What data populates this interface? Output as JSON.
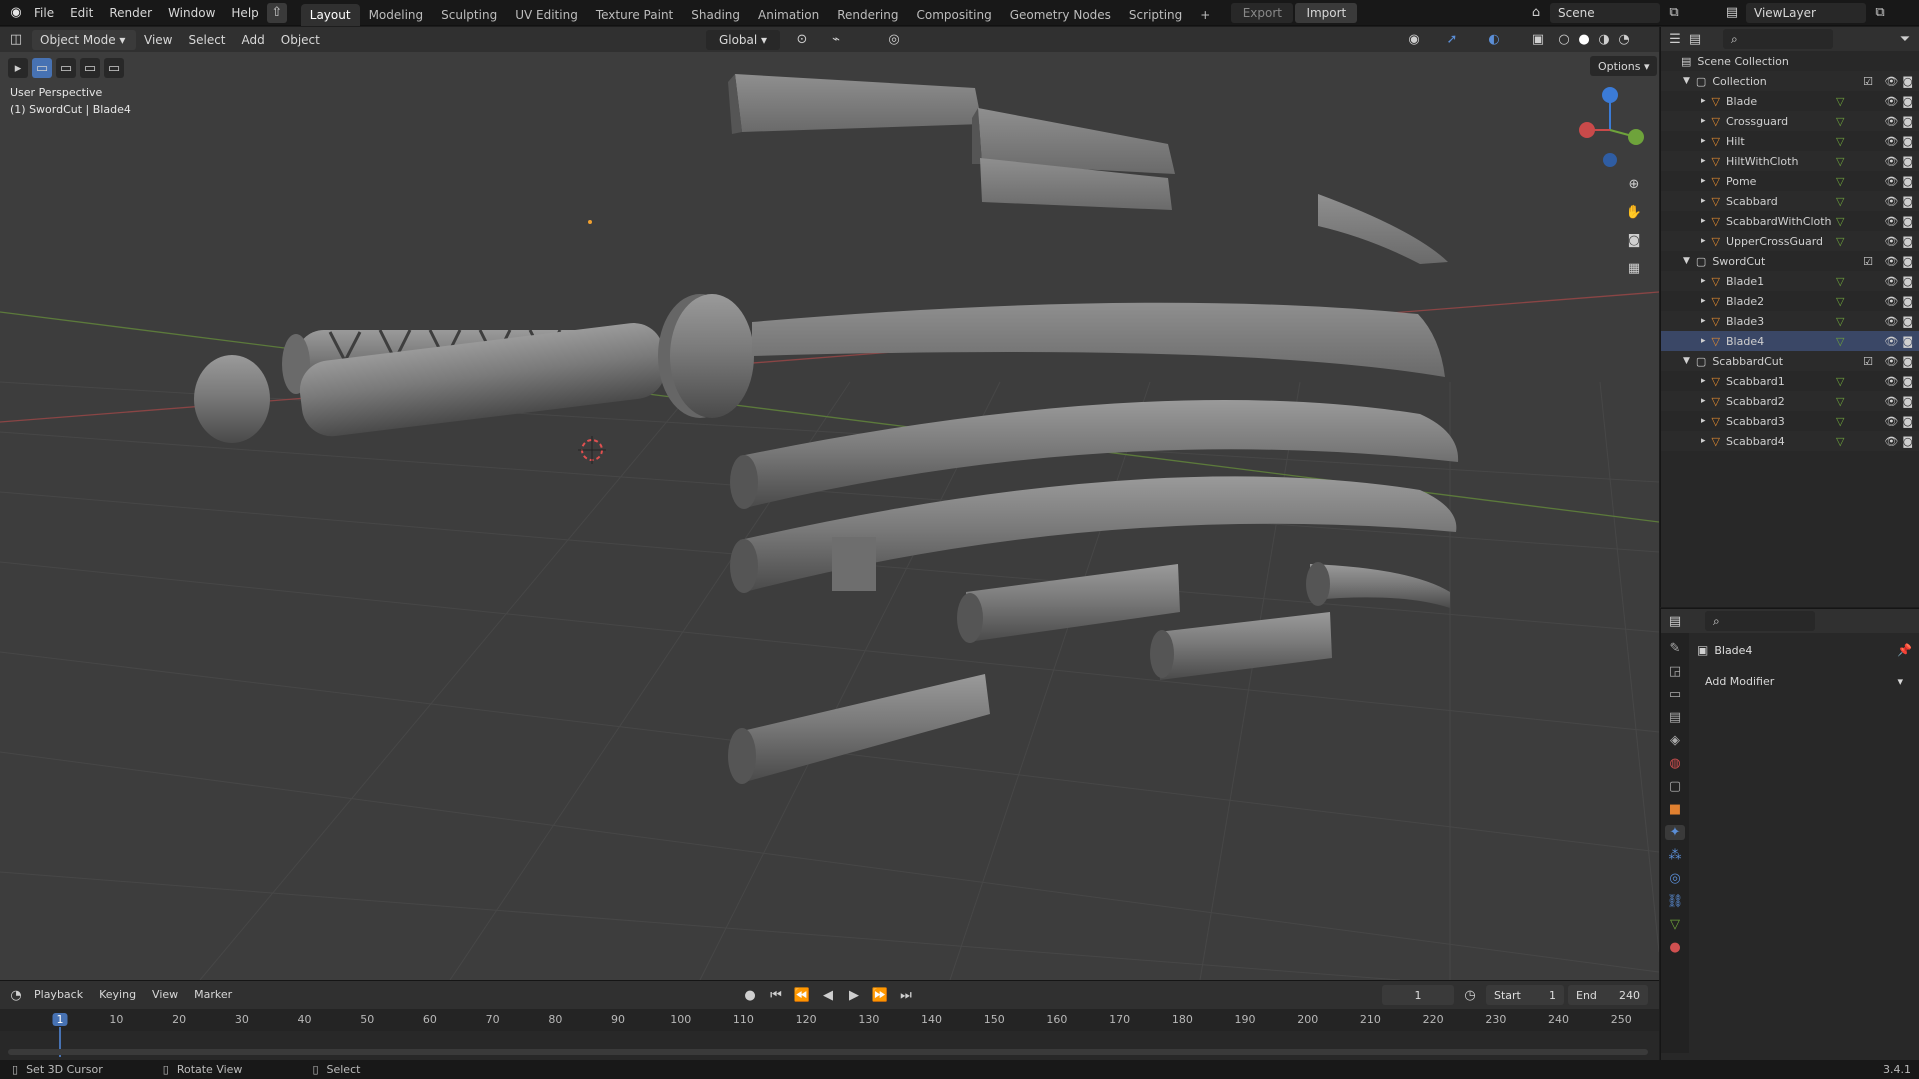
{
  "topbar": {
    "menus": [
      "File",
      "Edit",
      "Render",
      "Window",
      "Help"
    ],
    "workspaces": [
      "Layout",
      "Modeling",
      "Sculpting",
      "UV Editing",
      "Texture Paint",
      "Shading",
      "Animation",
      "Rendering",
      "Compositing",
      "Geometry Nodes",
      "Scripting"
    ],
    "active_workspace": "Layout",
    "export_label": "Export",
    "import_label": "Import",
    "scene_name": "Scene",
    "view_layer": "ViewLayer"
  },
  "viewport_header": {
    "mode": "Object Mode",
    "menus": [
      "View",
      "Select",
      "Add",
      "Object"
    ],
    "orientation": "Global",
    "options_label": "Options"
  },
  "viewport": {
    "view_name": "User Perspective",
    "active_info": "(1) SwordCut | Blade4"
  },
  "outliner": {
    "root": "Scene Collection",
    "collections": [
      {
        "name": "Collection",
        "items": [
          "Blade",
          "Crossguard",
          "Hilt",
          "HiltWithCloth",
          "Pome",
          "Scabbard",
          "ScabbardWithCloth",
          "UpperCrossGuard"
        ]
      },
      {
        "name": "SwordCut",
        "items": [
          "Blade1",
          "Blade2",
          "Blade3",
          "Blade4"
        ]
      },
      {
        "name": "ScabbardCut",
        "items": [
          "Scabbard1",
          "Scabbard2",
          "Scabbard3",
          "Scabbard4"
        ]
      }
    ],
    "active_item": "Blade4"
  },
  "properties": {
    "object_name": "Blade4",
    "add_modifier_label": "Add Modifier"
  },
  "timeline": {
    "menus": [
      "Playback",
      "Keying",
      "View",
      "Marker"
    ],
    "current_frame": "1",
    "start_label": "Start",
    "start": "1",
    "end_label": "End",
    "end": "240",
    "ticks": [
      "1",
      "10",
      "20",
      "30",
      "40",
      "50",
      "60",
      "70",
      "80",
      "90",
      "100",
      "110",
      "120",
      "130",
      "140",
      "150",
      "160",
      "170",
      "180",
      "190",
      "200",
      "210",
      "220",
      "230",
      "240",
      "250"
    ]
  },
  "statusbar": {
    "set_cursor": "Set 3D Cursor",
    "rotate": "Rotate View",
    "select": "Select",
    "version": "3.4.1"
  },
  "colors": {
    "viewport_bg": "#3d3d3d",
    "active_highlight": "#4772b3",
    "mesh_gray": "#8a8a8a",
    "axis_x": "#c94a4a",
    "axis_y": "#6ea33b",
    "axis_z": "#3b7bd6"
  }
}
